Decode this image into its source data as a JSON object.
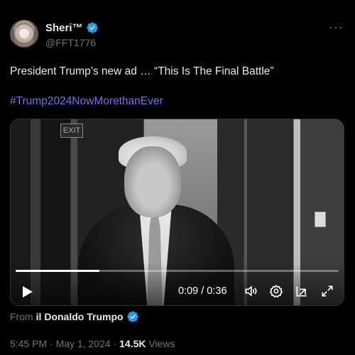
{
  "author": {
    "name": "Sheri™",
    "handle": "@FFT1776"
  },
  "more_label": "···",
  "tweet": {
    "text": "President Trump’s new ad … “This Is The Final Battle”",
    "hashtag": "#Trump2024NowMorethanEver"
  },
  "video": {
    "exit_sign": "EXIT",
    "time": "0:09 / 0:36",
    "progress": 0.26
  },
  "source": {
    "prefix": "From",
    "name": "il Donaldo Trumpo"
  },
  "meta": {
    "time": "5:45 PM",
    "sep1": " · ",
    "date": "May 1, 2024",
    "sep2": " · ",
    "views_count": "14.5K",
    "views_label": " Views"
  },
  "colors": {
    "verified": "#1d9bf0",
    "hashtag": "#7c6cf6"
  },
  "icons": [
    "verified-badge-icon",
    "more-icon",
    "play-icon",
    "volume-icon",
    "settings-icon",
    "pop-out-icon",
    "fullscreen-icon"
  ]
}
